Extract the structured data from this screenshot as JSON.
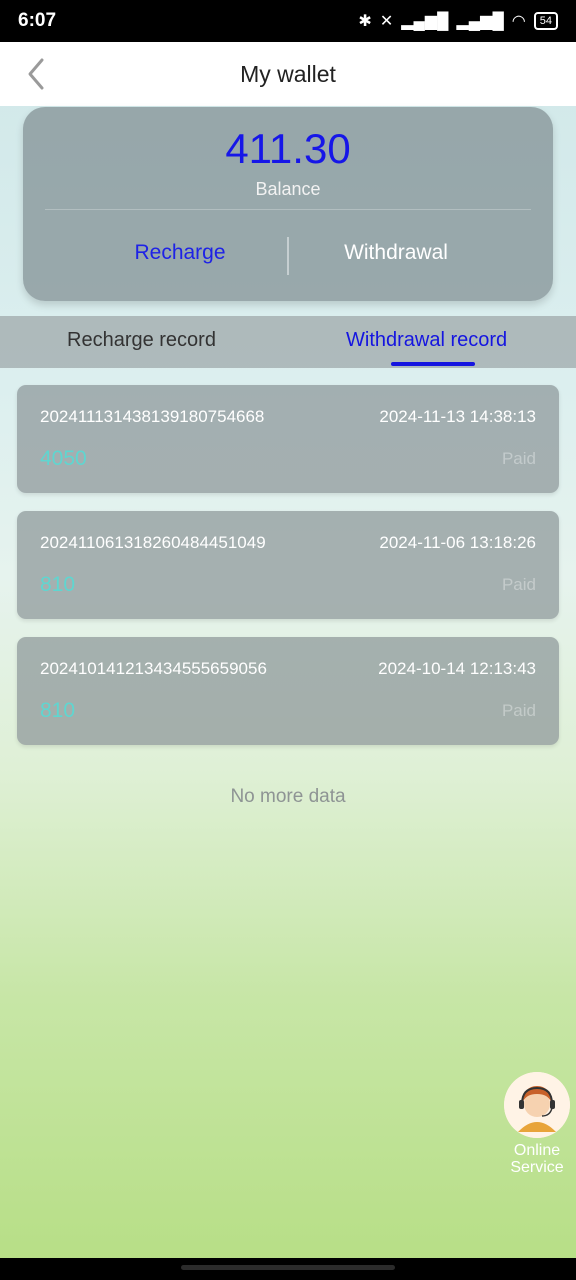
{
  "status_bar": {
    "time": "6:07",
    "battery": "54"
  },
  "header": {
    "title": "My wallet"
  },
  "balance_card": {
    "amount": "411.30",
    "label": "Balance",
    "recharge_label": "Recharge",
    "withdrawal_label": "Withdrawal"
  },
  "tabs": [
    {
      "label": "Recharge record",
      "active": false
    },
    {
      "label": "Withdrawal record",
      "active": true
    }
  ],
  "records": [
    {
      "order_no": "20241113143813918075466​8",
      "datetime": "2024-11-13 14:38:13",
      "amount": "4050",
      "status": "Paid"
    },
    {
      "order_no": "202411061318260484451049",
      "datetime": "2024-11-06 13:18:26",
      "amount": "810",
      "status": "Paid"
    },
    {
      "order_no": "202410141213434555659056",
      "datetime": "2024-10-14 12:13:43",
      "amount": "810",
      "status": "Paid"
    }
  ],
  "footer": {
    "no_more": "No more data"
  },
  "online_service": {
    "line1": "Online",
    "line2": "Service"
  },
  "colors": {
    "accent": "#1616e8",
    "amount": "#5fd6d0"
  }
}
